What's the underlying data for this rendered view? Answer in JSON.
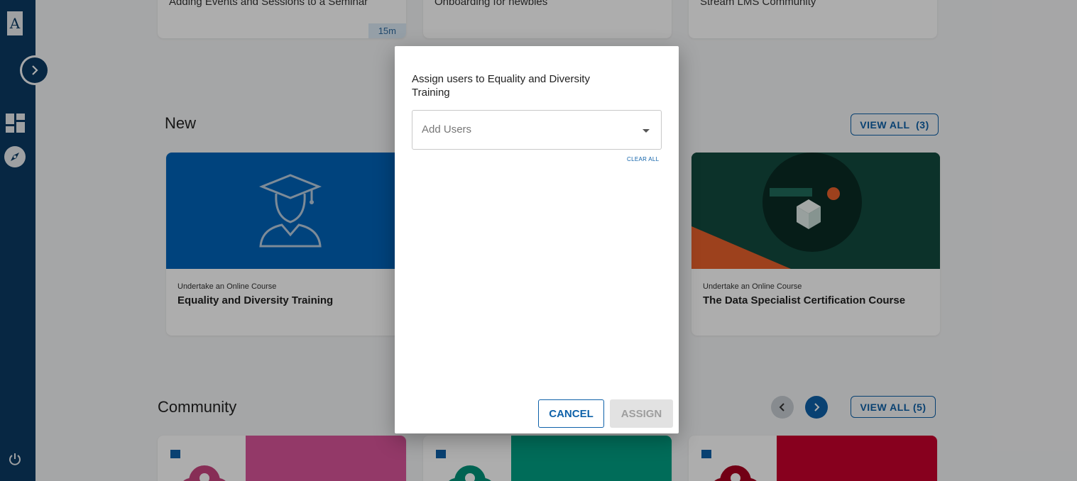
{
  "app": {
    "logo_letter": "A"
  },
  "top_cards": [
    {
      "title": "Adding Events and Sessions to a Seminar",
      "duration": "15m"
    },
    {
      "title": "Onboarding for newbies"
    },
    {
      "title": "Stream LMS Community"
    }
  ],
  "sections": {
    "new": {
      "title": "New",
      "view_all": "VIEW ALL  (3)",
      "courses": [
        {
          "category": "Undertake an Online Course",
          "title": "Equality and Diversity Training"
        },
        {
          "category": "Undertake an Online Course",
          "title": "The Data Specialist Certification Course"
        }
      ]
    },
    "community": {
      "title": "Community",
      "view_all": "VIEW ALL (5)"
    }
  },
  "modal": {
    "title": "Assign users to Equality and Diversity Training",
    "select_placeholder": "Add Users",
    "clear_all": "CLEAR ALL",
    "cancel": "CANCEL",
    "assign": "ASSIGN"
  },
  "colors": {
    "sidebar": "#0b3a63",
    "accent": "#0e61a9",
    "course_blue": "#0064b8",
    "community_pink": "#d9559a",
    "community_green": "#00a083",
    "community_red": "#c8002d"
  },
  "icons": {
    "expand": "chevron-right-icon",
    "dashboard": "dashboard-icon",
    "explore": "compass-icon",
    "logout": "power-icon",
    "graduate": "graduate-icon",
    "cube": "cube-icon"
  }
}
